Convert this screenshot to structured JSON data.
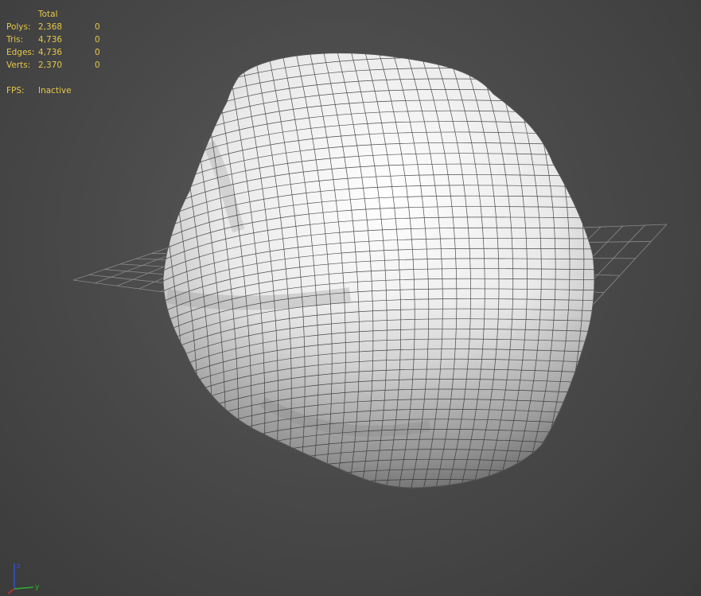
{
  "stats": {
    "header": "Total",
    "rows": [
      {
        "label": "Polys:",
        "total": "2,368",
        "selected": "0"
      },
      {
        "label": "Tris:",
        "total": "4,736",
        "selected": "0"
      },
      {
        "label": "Edges:",
        "total": "4,736",
        "selected": "0"
      },
      {
        "label": "Verts:",
        "total": "2,370",
        "selected": "0"
      }
    ],
    "fps_label": "FPS:",
    "fps_value": "Inactive"
  },
  "axis": {
    "z_label": "z",
    "y_label": "y",
    "x_color": "#c03030",
    "y_color": "#30b030",
    "z_color": "#3050d0"
  },
  "colors": {
    "stats_text": "#e6c84a",
    "mesh_fill": "#e8e8e8",
    "wire": "#303030",
    "grid": "#8a8a8a"
  }
}
